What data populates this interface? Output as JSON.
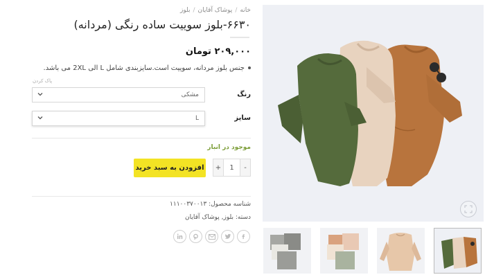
{
  "breadcrumb": {
    "items": [
      "خانه",
      "پوشاک آقایان",
      "بلوز"
    ],
    "separator": "/"
  },
  "product": {
    "title": "۶۶۳۰-بلوز سوییت ساده رنگی (مردانه)",
    "price": "۲۰۹,۰۰۰ تومان",
    "description": "جنس بلوز مردانه، سوییت است.سایزبندی شامل L الی 2XL می باشد.",
    "clear_link": "پاک کردن",
    "options": {
      "color_label": "رنگ",
      "color_value": "مشکی",
      "size_label": "سایز",
      "size_value": "L"
    },
    "stock": "موجود در انبار",
    "quantity": {
      "minus": "-",
      "value": "1",
      "plus": "+"
    },
    "add_to_cart": "افزودن به سبد خرید",
    "sku_label": "شناسه محصول:",
    "sku_value": "۱۱۱۰۰۳۷۰۰۱۳",
    "category_label": "دسته:",
    "category_value": "بلوز, پوشاک آقایان"
  },
  "social": [
    "facebook-icon",
    "twitter-icon",
    "email-icon",
    "pinterest-icon",
    "linkedin-icon"
  ],
  "colors": {
    "accent_yellow": "#f3e324",
    "stock_green": "#7a9c35",
    "shirt_olive": "#556b3c",
    "shirt_beige": "#e6d0bb",
    "shirt_tan": "#b8743d",
    "image_bg": "#eef0f5"
  }
}
